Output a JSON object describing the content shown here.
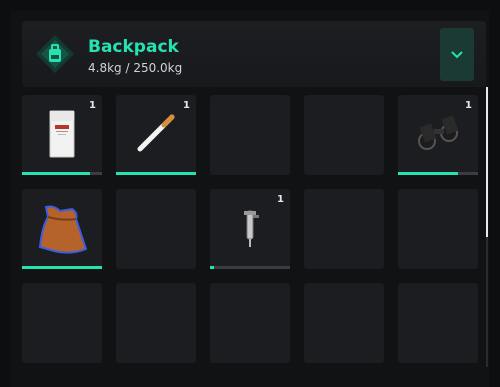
{
  "inventory": {
    "title": "Backpack",
    "weight": "4.8kg / 250.0kg",
    "accent_color": "#25e2b0",
    "collapse_icon": "chevron-down-icon",
    "slots": [
      {
        "item": "cigarette-pack",
        "qty": "1",
        "durability": 0.85
      },
      {
        "item": "cigarette",
        "qty": "1",
        "durability": 1.0
      },
      {
        "item": null
      },
      {
        "item": null
      },
      {
        "item": "binoculars",
        "qty": "1",
        "durability": 0.75
      },
      {
        "item": "tobacco-bag",
        "qty": "",
        "durability": 1.0
      },
      {
        "item": null
      },
      {
        "item": "lockpick",
        "qty": "1",
        "durability": 0.05
      },
      {
        "item": null
      },
      {
        "item": null
      },
      {
        "item": null
      },
      {
        "item": null
      },
      {
        "item": null
      },
      {
        "item": null
      },
      {
        "item": null
      }
    ]
  }
}
